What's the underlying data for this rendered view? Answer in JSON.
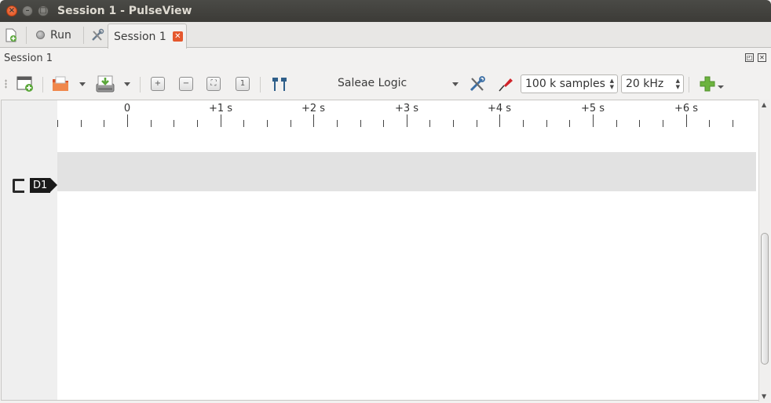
{
  "window": {
    "title": "Session 1 - PulseView"
  },
  "tabbar": {
    "run_label": "Run",
    "session_tab_label": "Session 1"
  },
  "dock": {
    "title": "Session 1"
  },
  "toolbar": {
    "device": "Saleae Logic",
    "samples": "100 k samples",
    "samplerate": "20 kHz"
  },
  "ruler": {
    "ticks": [
      "0",
      "+1 s",
      "+2 s",
      "+3 s",
      "+4 s",
      "+5 s",
      "+6 s"
    ]
  },
  "traces": [
    {
      "label": "D1"
    }
  ]
}
